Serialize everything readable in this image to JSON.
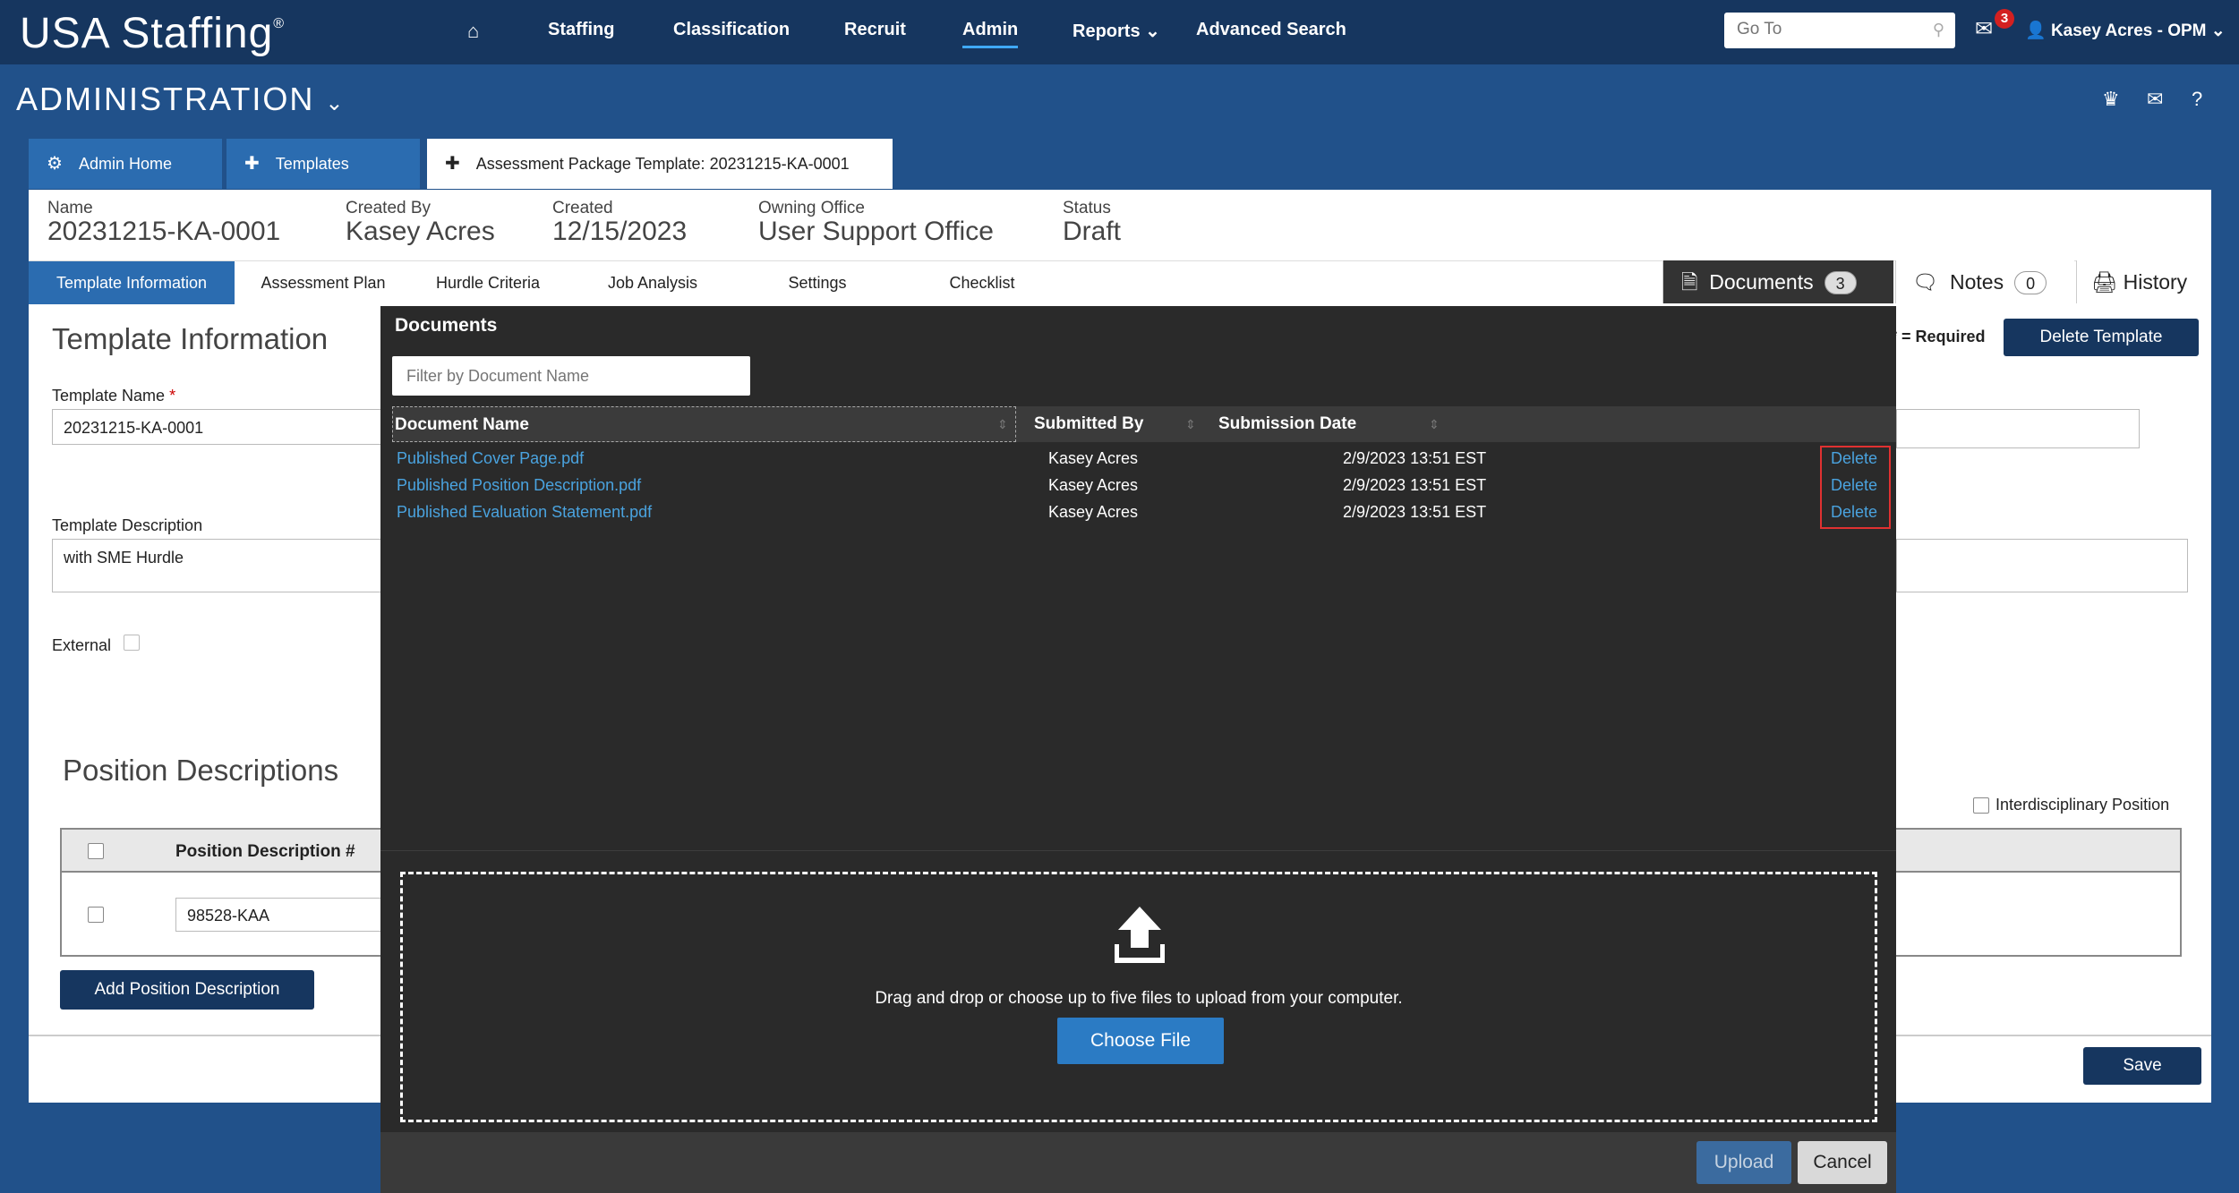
{
  "app": {
    "logo": "USA Staffing",
    "logo_mark": "®"
  },
  "nav": {
    "items": [
      "Staffing",
      "Classification",
      "Recruit",
      "Admin",
      "Reports",
      "Advanced Search"
    ],
    "active": "Admin",
    "goto_placeholder": "Go To",
    "mail_count": "3",
    "user": "Kasey Acres - OPM"
  },
  "header": {
    "title": "ADMINISTRATION"
  },
  "tabs": [
    {
      "label": "Admin Home",
      "icon": "gear-icon"
    },
    {
      "label": "Templates",
      "icon": "puzzle-icon"
    },
    {
      "label": "Assessment Package Template: 20231215-KA-0001",
      "icon": "puzzle-icon"
    }
  ],
  "meta": {
    "name_label": "Name",
    "name_value": "20231215-KA-0001",
    "created_by_label": "Created By",
    "created_by_value": "Kasey Acres",
    "created_label": "Created",
    "created_value": "12/15/2023",
    "office_label": "Owning Office",
    "office_value": "User Support Office",
    "status_label": "Status",
    "status_value": "Draft"
  },
  "steps": [
    "Template Information",
    "Assessment Plan",
    "Hurdle Criteria",
    "Job Analysis",
    "Settings",
    "Checklist"
  ],
  "side_tabs": {
    "documents_label": "Documents",
    "documents_count": "3",
    "notes_label": "Notes",
    "notes_count": "0",
    "history_label": "History"
  },
  "form": {
    "section_title": "Template Information",
    "required_note": "* = Required",
    "delete_template": "Delete Template",
    "name_label": "Template Name",
    "required_star": "*",
    "name_value": "20231215-KA-0001",
    "desc_label": "Template Description",
    "desc_value": "with SME Hurdle",
    "external_label": "External",
    "pd_title": "Position Descriptions",
    "interdisciplinary_label": "Interdisciplinary Position",
    "pd_col": "Position Description #",
    "pd_value": "98528-KAA",
    "add_pd": "Add Position Description",
    "save": "Save"
  },
  "modal": {
    "title": "Documents",
    "filter_placeholder": "Filter by Document Name",
    "columns": [
      "Document Name",
      "Submitted By",
      "Submission Date"
    ],
    "rows": [
      {
        "name": "Published Cover Page.pdf",
        "by": "Kasey Acres",
        "date": "2/9/2023 13:51 EST",
        "action": "Delete"
      },
      {
        "name": "Published Position Description.pdf",
        "by": "Kasey Acres",
        "date": "2/9/2023 13:51 EST",
        "action": "Delete"
      },
      {
        "name": "Published Evaluation Statement.pdf",
        "by": "Kasey Acres",
        "date": "2/9/2023 13:51 EST",
        "action": "Delete"
      }
    ],
    "drop_text": "Drag and drop or choose up to five files to upload from your computer.",
    "choose_file": "Choose File",
    "upload": "Upload",
    "cancel": "Cancel"
  }
}
